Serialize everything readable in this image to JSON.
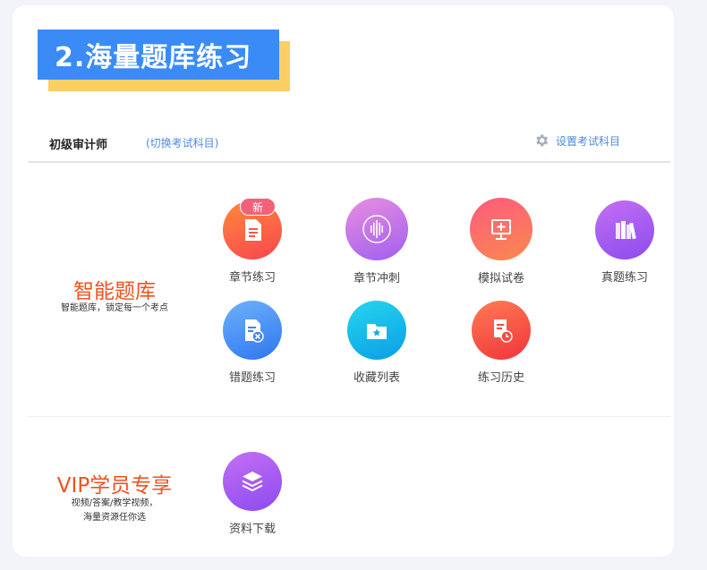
{
  "section": {
    "title": "2.海量题库练习"
  },
  "exam": {
    "name": "初级审计师",
    "switch_label": "(切换考试科目)",
    "settings_label": "设置考试科目"
  },
  "categories": [
    {
      "title": "智能题库",
      "subtitle": "智能题库，锁定每一个考点"
    },
    {
      "title": "VIP学员专享",
      "subtitle_line1": "视频/答案/教学视频，",
      "subtitle_line2": "海量资源任你选"
    }
  ],
  "items": [
    {
      "label": "章节练习",
      "badge": "新",
      "icon": "document-icon",
      "color": "#f8554e"
    },
    {
      "label": "章节冲刺",
      "icon": "sound-wave-icon",
      "color": "#c77ee8"
    },
    {
      "label": "模拟试卷",
      "icon": "monitor-plus-icon",
      "color": "#fb4e6b"
    },
    {
      "label": "真题练习",
      "icon": "books-icon",
      "color": "#a55af0"
    },
    {
      "label": "错题练习",
      "icon": "wrong-question-icon",
      "color": "#3d86f5"
    },
    {
      "label": "收藏列表",
      "icon": "star-folder-icon",
      "color": "#16aee8"
    },
    {
      "label": "练习历史",
      "icon": "history-clock-icon",
      "color": "#f9493b"
    },
    {
      "label": "资料下载",
      "icon": "layers-icon",
      "color": "#a65ef2"
    }
  ]
}
